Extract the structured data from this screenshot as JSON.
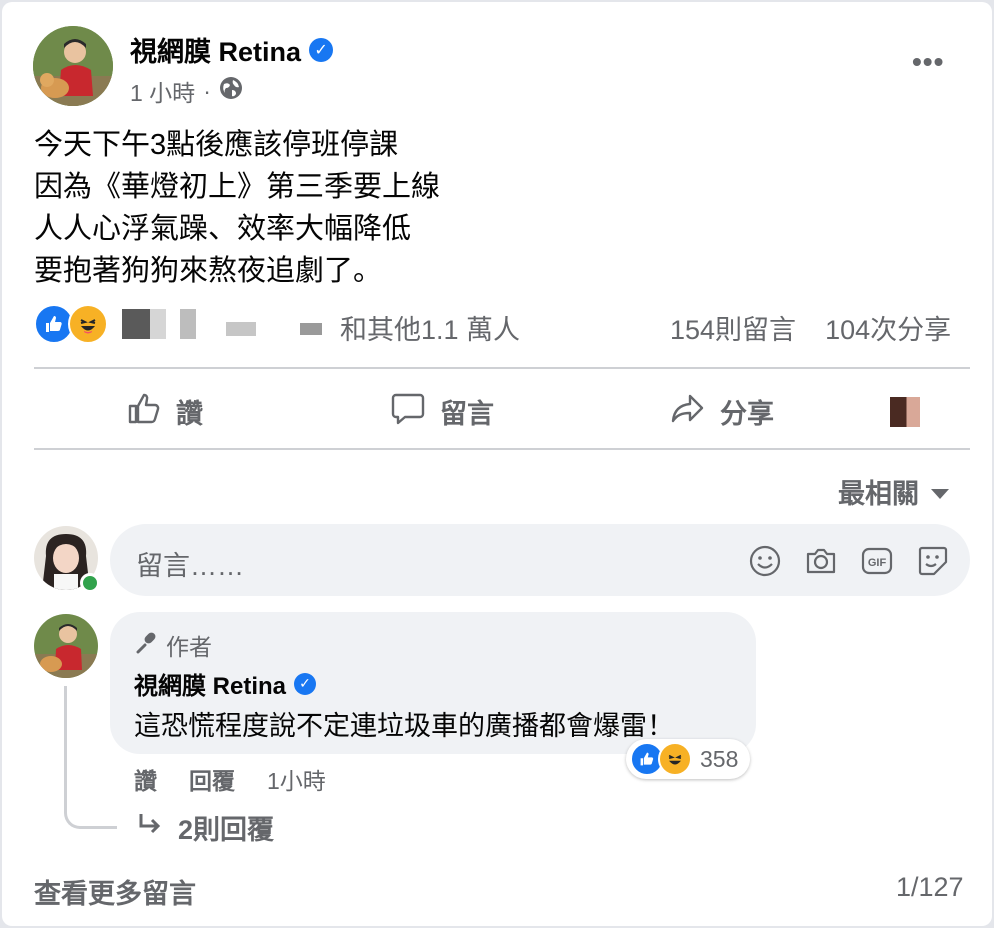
{
  "post": {
    "author": "視網膜 Retina",
    "verified_icon": "verified-check-icon",
    "time": "1 小時",
    "separator": "·",
    "privacy_icon": "globe-icon",
    "more_label": "•••",
    "lines": [
      "今天下午3點後應該停班停課",
      "因為《華燈初上》第三季要上線",
      "人人心浮氣躁、效率大幅降低",
      "要抱著狗狗來熬夜追劇了。"
    ],
    "reaction_icons": [
      "like-icon",
      "haha-icon"
    ],
    "reactors_text": "和其他1.1 萬人",
    "comment_count": "154則留言",
    "share_count": "104次分享"
  },
  "actions": {
    "like": "讚",
    "comment": "留言",
    "share": "分享"
  },
  "sort": {
    "label": "最相關"
  },
  "composer": {
    "placeholder": "留言……",
    "icons": [
      "emoji-icon",
      "camera-icon",
      "gif-icon",
      "sticker-icon"
    ]
  },
  "comment": {
    "badge": "作者",
    "author": "視網膜 Retina",
    "text": "這恐慌程度說不定連垃圾車的廣播都會爆雷！",
    "reaction_count": "358",
    "like_label": "讚",
    "reply_label": "回覆",
    "time": "1小時",
    "replies_label": "2則回覆"
  },
  "footer": {
    "view_more": "查看更多留言",
    "pager": "1/127"
  },
  "colors": {
    "facebook_blue": "#1877f2",
    "secondary_text": "#65676b",
    "bubble_bg": "#f0f2f5",
    "online_green": "#31a24c"
  }
}
